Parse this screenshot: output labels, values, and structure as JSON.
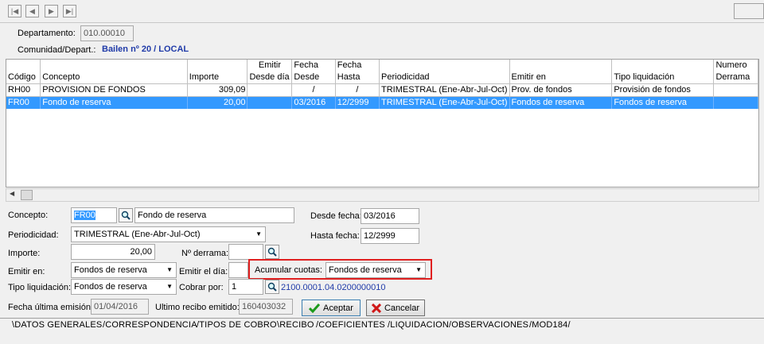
{
  "header": {
    "departamento_label": "Departamento:",
    "departamento_value": "010.00010",
    "comunidad_label": "Comunidad/Depart.:",
    "comunidad_value": "Bailen nº 20 / LOCAL"
  },
  "grid": {
    "top_headers": [
      "",
      "",
      "",
      "Emitir",
      "Fecha",
      "Fecha",
      "",
      "",
      "",
      "Numero"
    ],
    "headers": [
      "Código",
      "Concepto",
      "Importe",
      "Desde día",
      "Desde",
      "Hasta",
      "Periodicidad",
      "Emitir en",
      "Tipo liquidación",
      "Derrama"
    ],
    "rows": [
      [
        "RH00",
        "PROVISION DE FONDOS",
        "309,09",
        "",
        "/",
        "/",
        "TRIMESTRAL (Ene-Abr-Jul-Oct)",
        "Prov. de fondos",
        "Provisión de fondos",
        ""
      ],
      [
        "FR00",
        "Fondo de reserva",
        "20,00",
        "",
        "03/2016",
        "12/2999",
        "TRIMESTRAL (Ene-Abr-Jul-Oct)",
        "Fondos de reserva",
        "Fondos de reserva",
        ""
      ]
    ],
    "selected_row": 1
  },
  "form": {
    "concepto_label": "Concepto:",
    "concepto_code": "FR00",
    "concepto_desc": "Fondo de reserva",
    "desde_fecha_label": "Desde fecha:",
    "desde_fecha": "03/2016",
    "hasta_fecha_label": "Hasta fecha:",
    "hasta_fecha": "12/2999",
    "periodicidad_label": "Periodicidad:",
    "periodicidad": "TRIMESTRAL (Ene-Abr-Jul-Oct)",
    "importe_label": "Importe:",
    "importe": "20,00",
    "derrama_label": "Nº derrama:",
    "derrama": "",
    "emitir_en_label": "Emitir en:",
    "emitir_en": "Fondos de reserva",
    "emitir_dia_label": "Emitir el día:",
    "emitir_dia": "",
    "acumular_label": "Acumular cuotas:",
    "acumular": "Fondos de reserva",
    "tipo_liq_label": "Tipo liquidación:",
    "tipo_liq": "Fondos de reserva",
    "cobrar_label": "Cobrar por:",
    "cobrar": "1",
    "cuenta": "2100.0001.04.0200000010",
    "fecha_ult_label": "Fecha última emisión:",
    "fecha_ult": "01/04/2016",
    "ult_recibo_label": "Ultimo recibo emitido:",
    "ult_recibo": "160403032",
    "aceptar": "Aceptar",
    "cancelar": "Cancelar"
  },
  "tabs": [
    "DATOS GENERALES",
    "CORRESPONDENCIA",
    "TIPOS DE COBRO",
    "RECIBO",
    "COEFICIENTES",
    "LIQUIDACION",
    "OBSERVACIONES",
    "MOD184"
  ],
  "colors": {
    "selection": "#3399ff",
    "highlight_box": "#e02020",
    "link_blue": "#1f3aa8"
  }
}
